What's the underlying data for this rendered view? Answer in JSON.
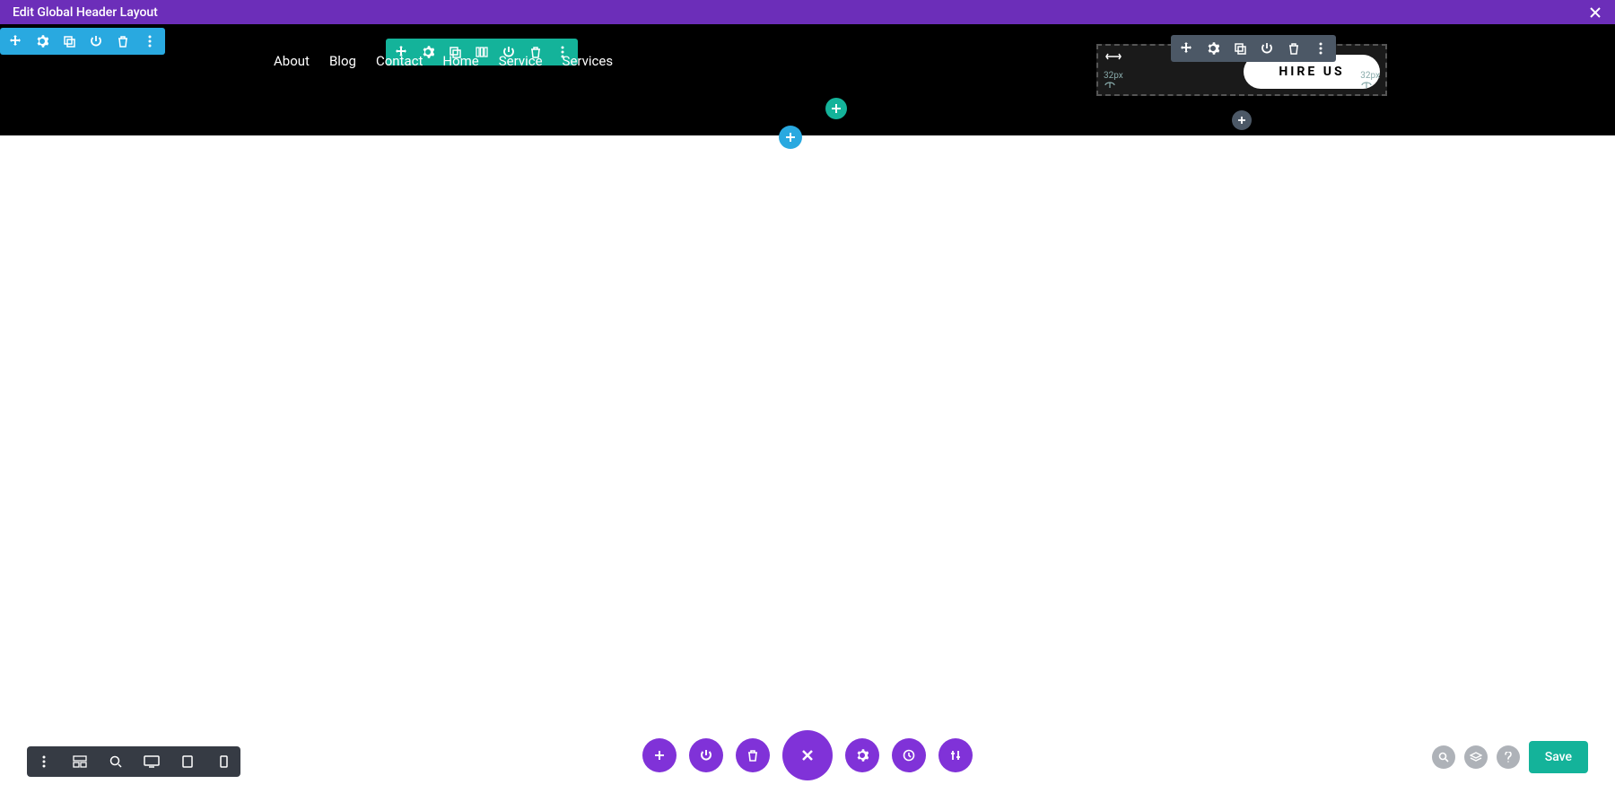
{
  "top": {
    "title": "Edit Global Header Layout"
  },
  "nav": {
    "items": [
      "About",
      "Blog",
      "Contact",
      "Home",
      "Service",
      "Services"
    ]
  },
  "cta": {
    "label": "HIRE US",
    "pad_l": "32px",
    "pad_r": "32px"
  },
  "actions": {
    "save": "Save"
  }
}
